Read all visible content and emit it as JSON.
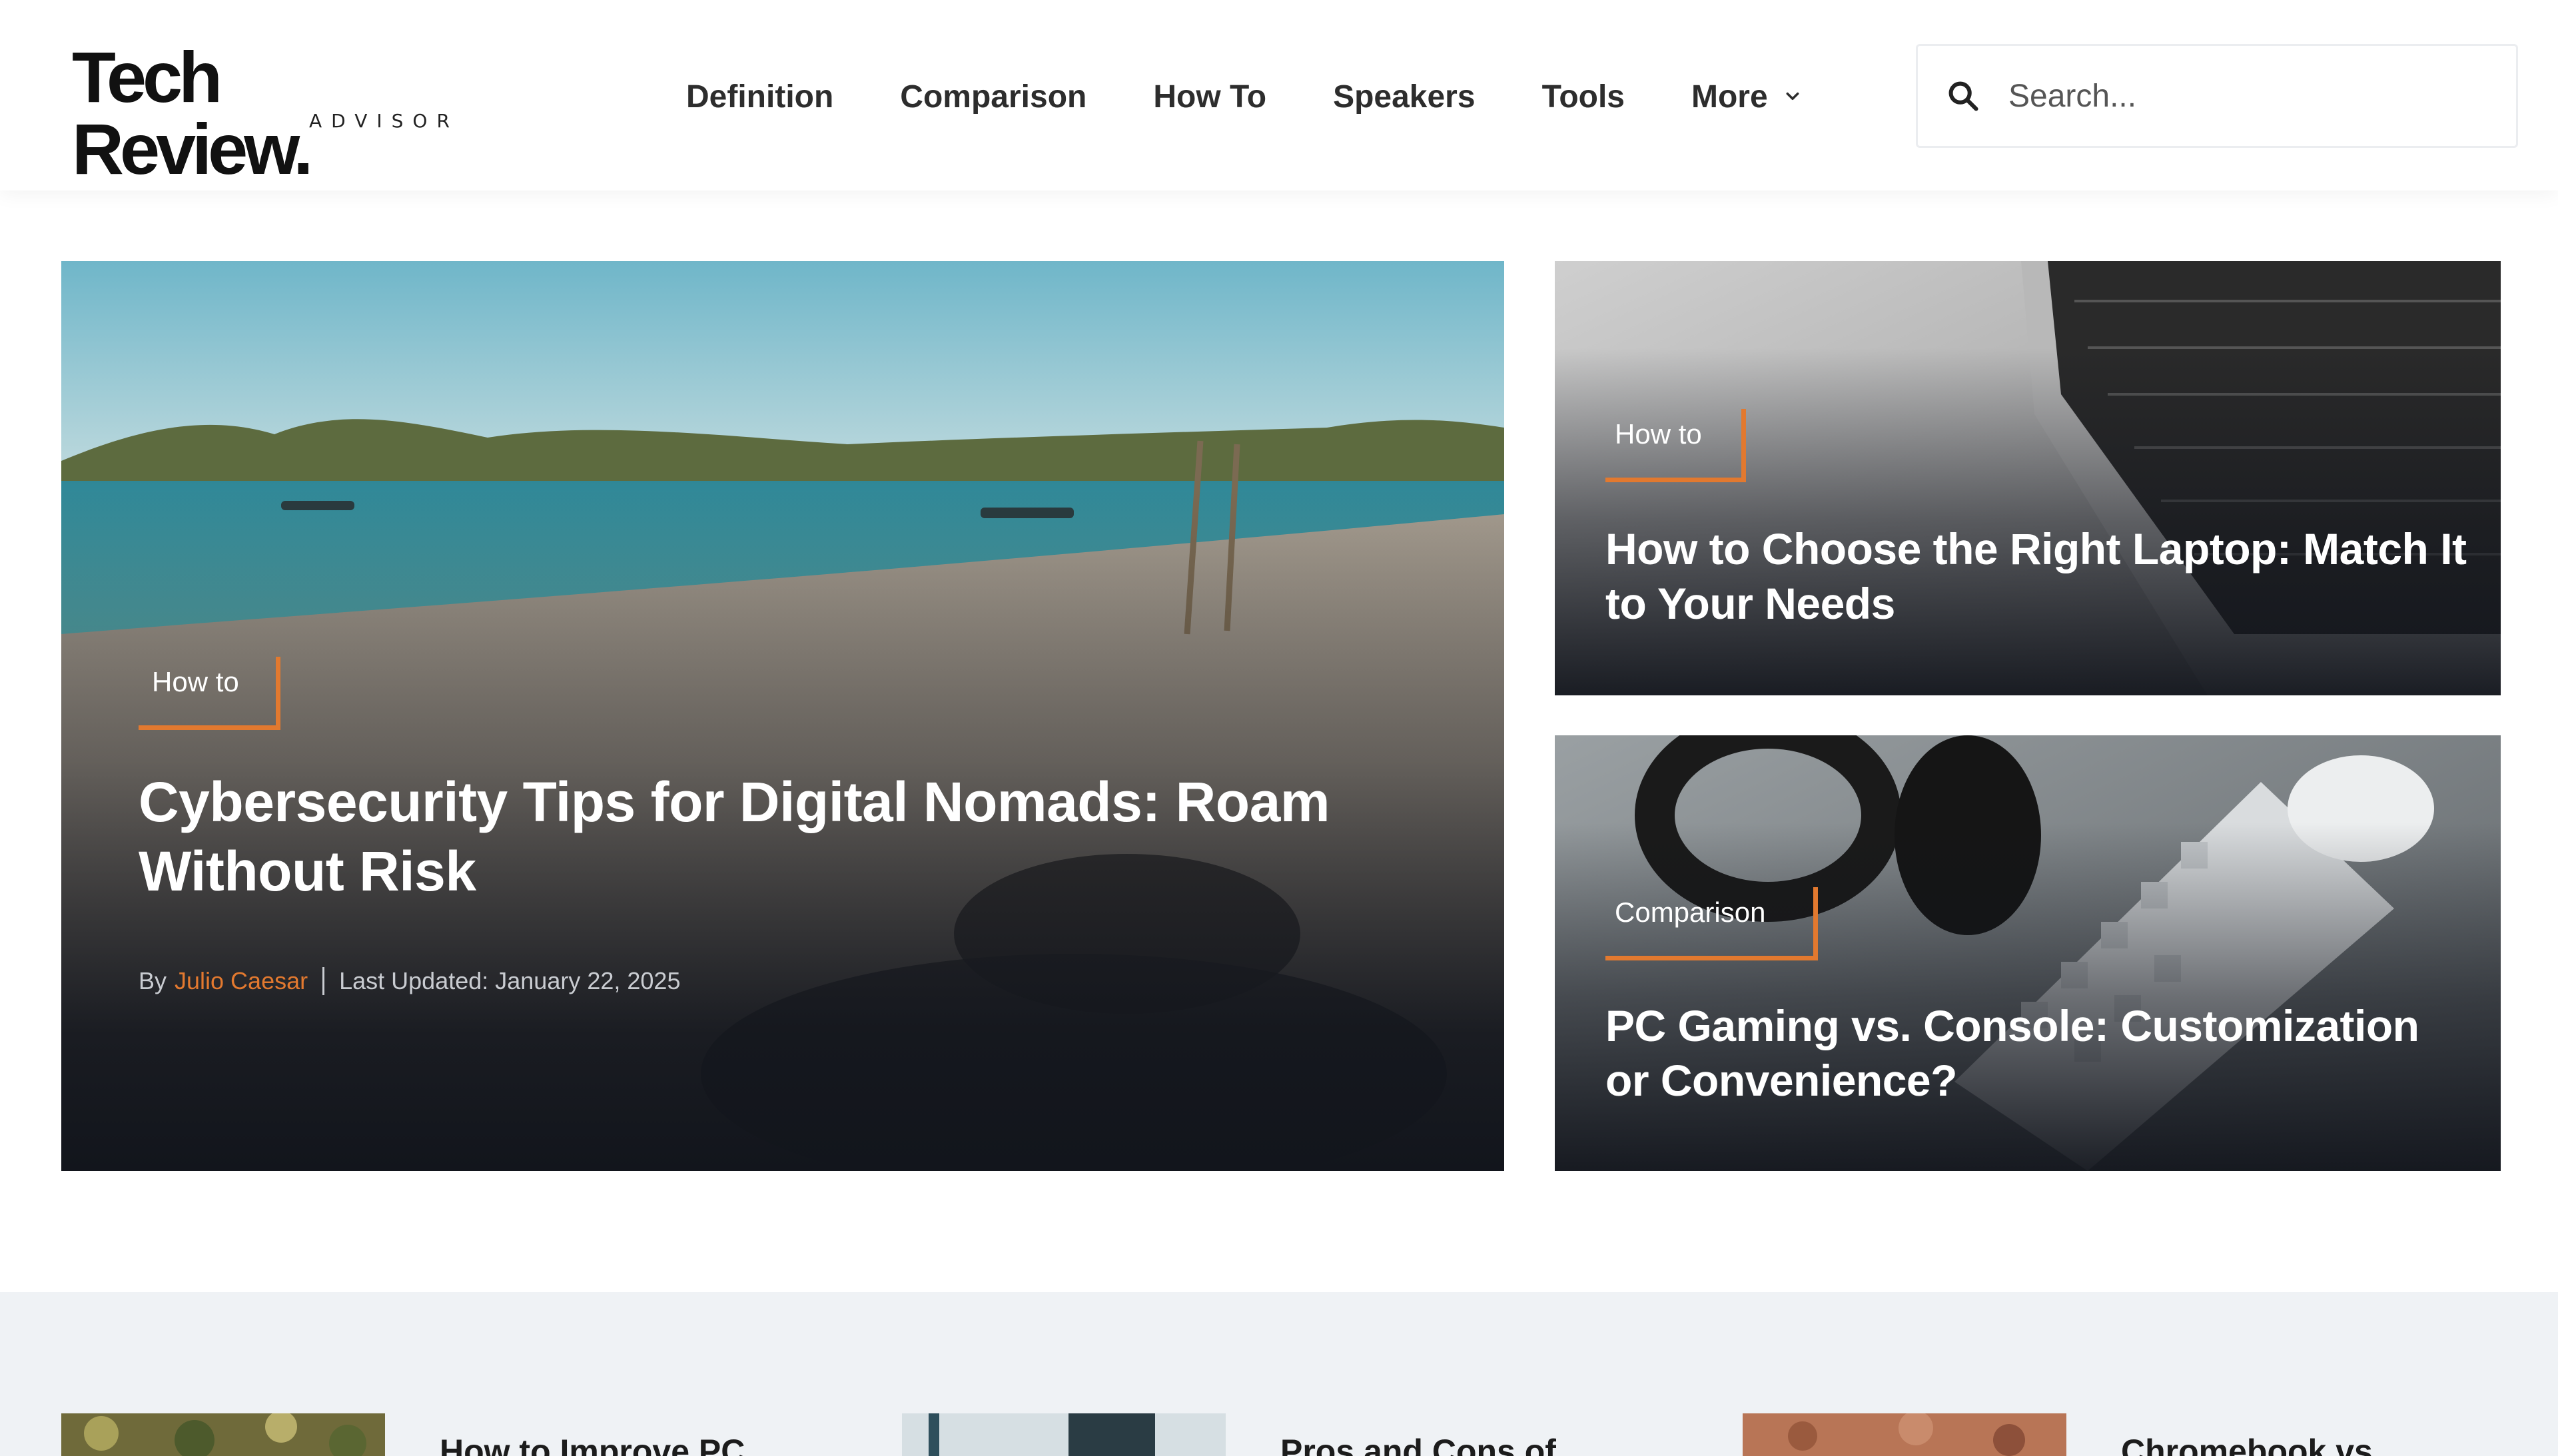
{
  "brand": {
    "name": "Tech Review.",
    "tagline": "ADVISOR"
  },
  "nav": {
    "items": [
      "Definition",
      "Comparison",
      "How To",
      "Speakers",
      "Tools",
      "More"
    ]
  },
  "search": {
    "placeholder": "Search..."
  },
  "hero": {
    "category": "How to",
    "title": "Cybersecurity Tips for Digital Nomads: Roam Without Risk",
    "by_label": "By",
    "author": "Julio Caesar",
    "updated": "Last Updated: January 22, 2025"
  },
  "side_cards": [
    {
      "category": "How to",
      "title": "How to Choose the Right Laptop: Match It to Your Needs"
    },
    {
      "category": "Comparison",
      "title": "PC Gaming vs. Console: Customization or Convenience?"
    }
  ],
  "lower_posts": [
    {
      "title": "How to Improve PC"
    },
    {
      "title": "Pros and Cons of"
    },
    {
      "title": "Chromebook vs"
    }
  ],
  "colors": {
    "accent": "#e2792f",
    "dark": "#12151c",
    "strip": "#eff2f5"
  },
  "icons": {
    "search": "search-icon",
    "more": "chevron-down-icon"
  }
}
